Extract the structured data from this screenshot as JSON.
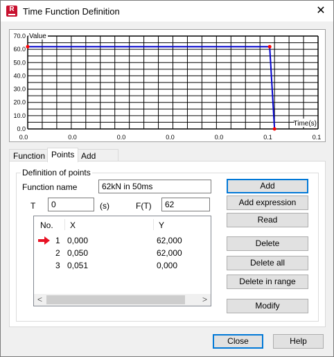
{
  "window": {
    "title": "Time Function Definition",
    "app_icon_letter": "R",
    "close_glyph": "✕"
  },
  "chart_data": {
    "type": "line",
    "xlabel": "Time(s)",
    "ylabel": "Value",
    "y_ticks": [
      "70.0",
      "60.0",
      "50.0",
      "40.0",
      "30.0",
      "20.0",
      "10.0",
      "0.0"
    ],
    "x_ticks": [
      "0.0",
      "0.0",
      "0.0",
      "0.0",
      "0.0",
      "0.1",
      "0.1"
    ],
    "ylim": [
      0,
      70
    ],
    "xlim": [
      0,
      0.06
    ],
    "grid": true,
    "x": [
      0.0,
      0.05,
      0.051
    ],
    "y": [
      62.0,
      62.0,
      0.0
    ],
    "line_color": "#0000cc",
    "point_color": "#ff0000"
  },
  "tabs": [
    {
      "label": "Function"
    },
    {
      "label": "Points"
    },
    {
      "label": "Add functions"
    }
  ],
  "definition": {
    "group_title": "Definition of points",
    "function_name_label": "Function name",
    "function_name_value": "62kN in 50ms",
    "t_label": "T",
    "t_value": "0",
    "t_unit": "(s)",
    "ft_label": "F(T)",
    "ft_value": "62"
  },
  "points_list": {
    "columns": [
      "No.",
      "X",
      "Y"
    ],
    "rows": [
      {
        "no": "1",
        "x": "0,000",
        "y": "62,000"
      },
      {
        "no": "2",
        "x": "0,050",
        "y": "62,000"
      },
      {
        "no": "3",
        "x": "0,051",
        "y": "0,000"
      }
    ],
    "scroll_left": "<",
    "scroll_right": ">"
  },
  "buttons": {
    "add": "Add",
    "add_expression": "Add expression",
    "read": "Read",
    "delete": "Delete",
    "delete_all": "Delete all",
    "delete_in_range": "Delete in range",
    "modify": "Modify",
    "close": "Close",
    "help": "Help"
  }
}
